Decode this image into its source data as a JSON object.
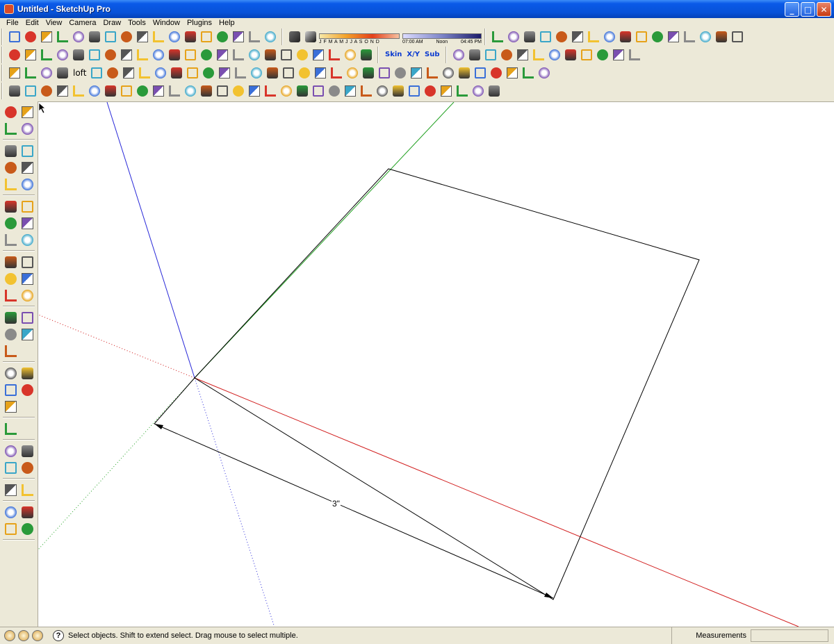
{
  "window": {
    "title": "Untitled - SketchUp Pro",
    "minimize_label": "_",
    "maximize_label": "□",
    "close_label": "✕"
  },
  "menu": [
    "File",
    "Edit",
    "View",
    "Camera",
    "Draw",
    "Tools",
    "Window",
    "Plugins",
    "Help"
  ],
  "shadow_settings": {
    "months": "J F M A M J J A S O N D",
    "time_start": "07:00 AM",
    "time_noon": "Noon",
    "time_end": "04:45 PM"
  },
  "toolbar_labels": {
    "loft": "loft",
    "skin": "Skin",
    "xy": "X/Y",
    "sub": "Sub"
  },
  "icons": {
    "toolbar_row1": [
      "new-icon",
      "open-icon",
      "save-icon",
      "cut-icon",
      "copy-icon",
      "paste-icon",
      "erase-icon",
      "undo-icon",
      "redo-icon",
      "print-icon",
      "model-info-icon",
      "iso-view-icon",
      "top-view-icon",
      "front-view-icon",
      "right-view-icon",
      "back-view-icon",
      "left-view-icon",
      "shadows-icon",
      "fog-icon",
      "xray-icon",
      "wireframe-icon",
      "hidden-line-icon",
      "shaded-icon",
      "shaded-texture-icon",
      "monochrome-icon",
      "sandbox-smoove-icon",
      "sandbox-stamp-icon",
      "hand-icon",
      "component-icon",
      "layers-icon",
      "outliner-icon",
      "scenes-icon",
      "section-icon"
    ],
    "toolbar_row2": [
      "line-tool-icon",
      "edge-tool-icon",
      "intersect-icon",
      "rect-tool-icon",
      "arc-tool-icon",
      "circle-slash-icon",
      "rect-slash-icon",
      "hatch-icon",
      "bezier-icon",
      "curve-icon",
      "polyline-icon",
      "spline-icon",
      "arc3-icon",
      "rounded-rect-icon",
      "spiral-icon",
      "arc-curve-icon",
      "wave-icon",
      "arc-half-icon",
      "zigzag-icon",
      "polygon-icon",
      "wrench-icon",
      "ellipse-icon",
      "bulge-icon",
      "skin-icon",
      "xy-icon",
      "sub-icon",
      "play-icon",
      "stop-icon",
      "reload-icon",
      "cube-outline-icon",
      "cube-grid-icon",
      "pyramid-icon",
      "axes-icon",
      "knife-icon",
      "frame-icon",
      "bookshelf-icon",
      "scroll-icon",
      "book-icon"
    ],
    "toolbar_row3": [
      "follow-me-icon",
      "lathe-icon",
      "star-icon",
      "arc-bridge-icon",
      "loft-icon",
      "box-solid-icon",
      "box-split-icon",
      "box-wire-icon",
      "paint-face-icon",
      "prism-icon",
      "double-arrow-icon",
      "push-up-icon",
      "diagonal-icon",
      "mirror-icon",
      "rotate-left-icon",
      "rotate-right-icon",
      "bend-icon",
      "push-red-icon",
      "tilt-icon",
      "tilt-alt-icon",
      "flex-icon",
      "twist-icon",
      "lift-icon",
      "bomb-icon",
      "group-icon",
      "shaded-box-icon",
      "snow-icon",
      "cube-lines-icon",
      "fork-icon",
      "scissors-icon",
      "paint-brush-icon",
      "blob-icon",
      "person-icon"
    ],
    "toolbar_row4": [
      "pan-icon",
      "pencil-icon",
      "box-a-icon",
      "box-b-icon",
      "box-c-icon",
      "box-d-icon",
      "panel-icon",
      "arch-icon",
      "dome-icon",
      "rail-icon",
      "loop-icon",
      "ring-icon",
      "ruler-icon",
      "eraser-pink-icon",
      "scrub-icon",
      "dot-icon",
      "grid-a-icon",
      "grid-b-icon",
      "grid-c-icon",
      "grid-d-icon",
      "grid-e-icon",
      "star-lines-icon",
      "grid-f-icon",
      "tshape-icon",
      "plane-icon",
      "window-icon",
      "frame-a-icon",
      "frame-b-icon",
      "box-ochre-icon",
      "gift-icon",
      "stack-icon"
    ],
    "left_toolbar": [
      "select-tool-icon",
      "component-tool-icon",
      "paint-bucket-icon",
      "eraser-tool-icon",
      "rectangle-tool-icon",
      "pencil-line-icon",
      "circle-tool-icon",
      "arc-tool-left-icon",
      "polygon-tool-icon",
      "freehand-tool-icon",
      "move-tool-icon",
      "push-pull-icon",
      "rotate-tool-icon",
      "follow-me-left-icon",
      "scale-tool-icon",
      "offset-tool-icon",
      "tape-measure-icon",
      "dimension-tool-icon",
      "protractor-icon",
      "text-tool-icon",
      "axes-tool-icon",
      "3d-text-icon",
      "orbit-icon",
      "pan-hand-icon",
      "zoom-icon",
      "zoom-window-icon",
      "zoom-extents-icon",
      "previous-view-icon",
      "next-view-icon",
      "position-camera-icon",
      "look-around-icon",
      "walk-icon",
      "section-plane-icon",
      "geo-location-icon",
      "photo-texture-icon",
      "google-earth-icon",
      "earth-toggle-icon",
      "get-models-icon",
      "share-model-icon",
      "share-component-icon",
      "credits-icon",
      "match-photo-icon",
      "sandbox-icon"
    ]
  },
  "viewport": {
    "dimension_label": "3\""
  },
  "axis_colors": {
    "red": "#d11c1c",
    "green": "#20a020",
    "blue": "#2828d8"
  },
  "status": {
    "hint": "Select objects. Shift to extend select. Drag mouse to select multiple.",
    "help_label": "?",
    "measurements_label": "Measurements",
    "measurements_value": ""
  }
}
